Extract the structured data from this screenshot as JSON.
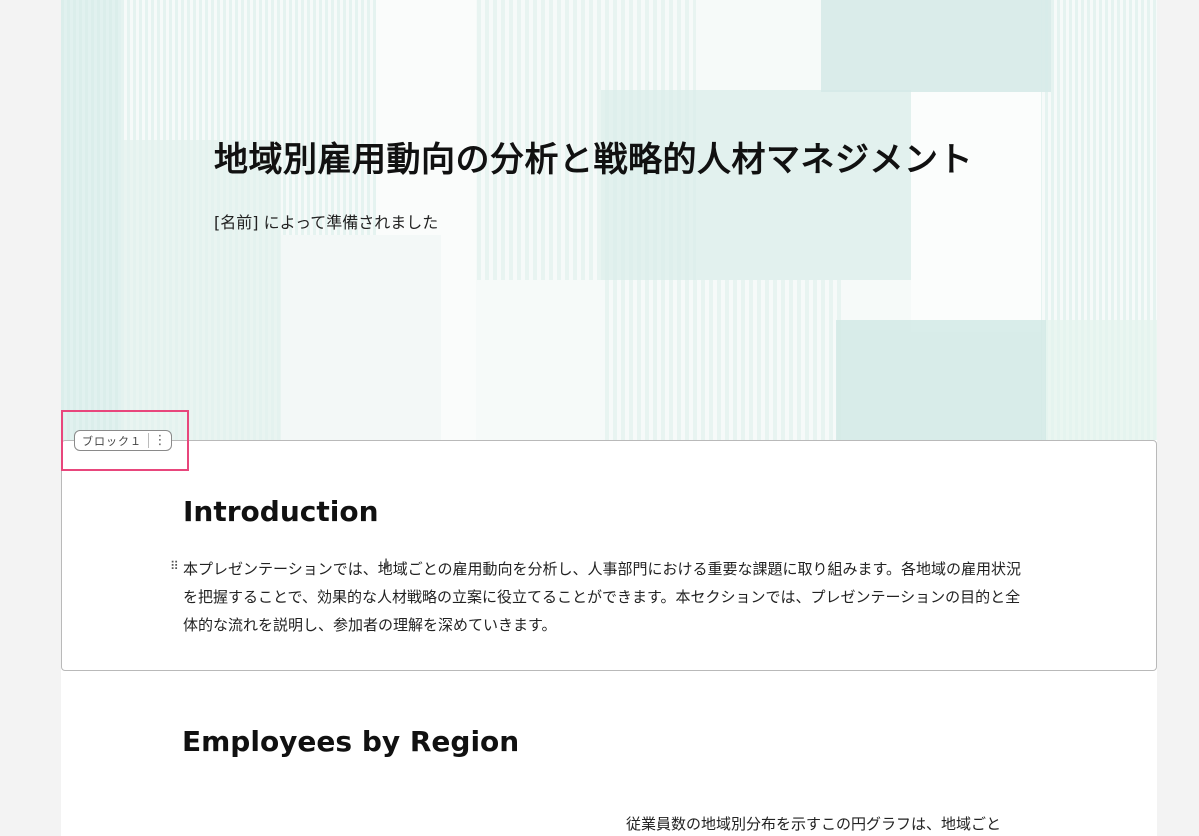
{
  "hero": {
    "title": "地域別雇用動向の分析と戦略的人材マネジメント",
    "subtitle": "[名前] によって準備されました"
  },
  "block_tag": {
    "label": "ブロック１",
    "menu_icon": "more-vertical-icon"
  },
  "introduction": {
    "heading": "Introduction",
    "body": "本プレゼンテーションでは、地域ごとの雇用動向を分析し、人事部門における重要な課題に取り組みます。各地域の雇用状況を把握することで、効果的な人材戦略の立案に役立てることができます。本セクションでは、プレゼンテーションの目的と全体的な流れを説明し、参加者の理解を深めていきます。"
  },
  "employees_by_region": {
    "heading": "Employees by Region",
    "body_start": "従業員数の地域別分布を示すこの円グラフは、地域ごと"
  },
  "colors": {
    "accent_highlight": "#e8467c",
    "hero_tint": "#cfe8e6"
  }
}
